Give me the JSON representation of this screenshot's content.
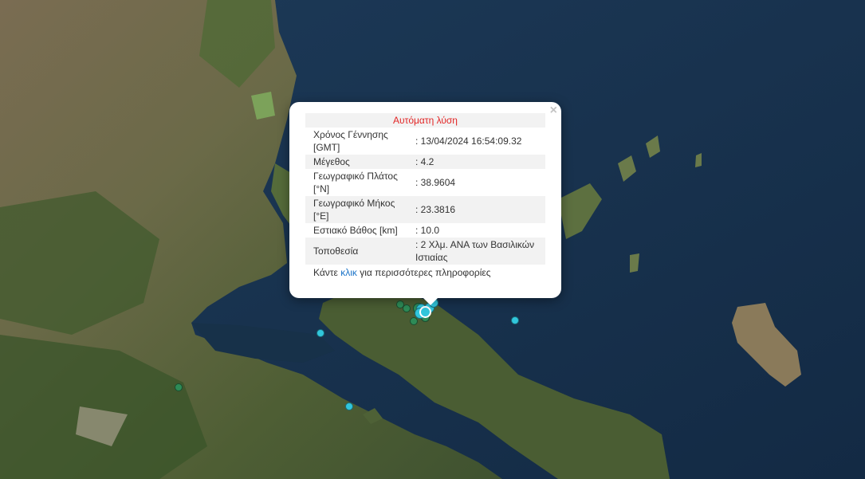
{
  "popup": {
    "title": "Αυτόματη λύση",
    "close_label": "×",
    "rows": [
      {
        "label": "Χρόνος Γέννησης [GMT]",
        "value": ": 13/04/2024 16:54:09.32"
      },
      {
        "label": "Μέγεθος",
        "value": ": 4.2"
      },
      {
        "label": "Γεωγραφικό Πλάτος [°N]",
        "value": ": 38.9604"
      },
      {
        "label": "Γεωγραφικό Μήκος [°E]",
        "value": ": 23.3816"
      },
      {
        "label": "Εστιακό Βάθος [km]",
        "value": ": 10.0"
      },
      {
        "label": "Τοποθεσία",
        "value": ": 2 Χλμ. ΑΝΑ των Βασιλικών Ιστιαίας"
      }
    ],
    "more_prefix": "Κάντε ",
    "more_link": "κλικ",
    "more_suffix": " για περισσότερες πληροφορίες"
  },
  "colors": {
    "sea": "#17304a",
    "land": "#5a6a3c",
    "marker_recent": "#31c6dc",
    "marker_older": "#2e8b57",
    "title_red": "#e32626",
    "link_blue": "#1a73c8"
  }
}
